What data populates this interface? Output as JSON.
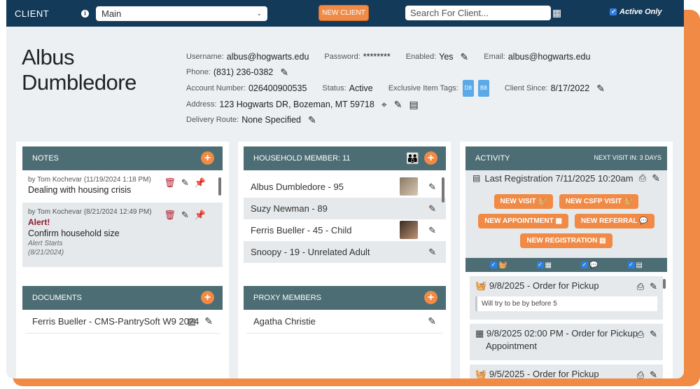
{
  "app": {
    "brand": "CLIENT",
    "select_value": "Main",
    "new_client_label": "NEW CLIENT",
    "search_placeholder": "Search For Client...",
    "active_only_label": "Active Only"
  },
  "client": {
    "name": "Albus Dumbledore",
    "username_label": "Username:",
    "username": "albus@hogwarts.edu",
    "password_label": "Password:",
    "password": "********",
    "enabled_label": "Enabled:",
    "enabled": "Yes",
    "email_label": "Email:",
    "email": "albus@hogwarts.edu",
    "phone_label": "Phone:",
    "phone": "(831) 236-0382",
    "account_label": "Account Number:",
    "account": "026400900535",
    "status_label": "Status:",
    "status": "Active",
    "tags_label": "Exclusive Item Tags:",
    "tags": [
      "D8",
      "B8"
    ],
    "since_label": "Client Since:",
    "since": "8/17/2022",
    "address_label": "Address:",
    "address": "123 Hogwarts DR, Bozeman, MT 59718",
    "route_label": "Delivery Route:",
    "route": "None Specified"
  },
  "notes": {
    "title": "NOTES",
    "items": [
      {
        "meta": "by Tom Kochevar (11/19/2024 1:18 PM)",
        "text": "Dealing with housing crisis"
      },
      {
        "meta": "by Tom Kochevar (8/21/2024 12:49 PM)",
        "alert": "Alert!",
        "text": "Confirm household size",
        "starts_label": "Alert Starts",
        "starts_date": "(8/21/2024)"
      }
    ]
  },
  "household": {
    "title": "HOUSEHOLD MEMBER: 11",
    "members": [
      "Albus Dumbledore - 95",
      "Suzy Newman - 89",
      "Ferris Bueller - 45 - Child",
      "Snoopy - 19 - Unrelated Adult"
    ]
  },
  "activity": {
    "title": "ACTIVITY",
    "next_visit": "NEXT VISIT IN: 3 DAYS",
    "last_registration": "Last Registration 7/11/2025 10:20am",
    "buttons": {
      "new_visit": "NEW VISIT",
      "new_csfp": "NEW CSFP VISIT",
      "new_appointment": "NEW APPOINTMENT",
      "new_referral": "NEW REFERRAL",
      "new_registration": "NEW REGISTRATION"
    },
    "orders": [
      {
        "title": "9/8/2025 - Order for Pickup",
        "note": "Will try to be by before 5"
      },
      {
        "title": "9/8/2025 02:00 PM - Order for Pickup",
        "subtitle": "Appointment"
      },
      {
        "title": "9/5/2025 - Order for Pickup"
      }
    ]
  },
  "documents": {
    "title": "DOCUMENTS",
    "items": [
      "Ferris Bueller - CMS-PantrySoft W9 2024"
    ]
  },
  "proxy": {
    "title": "PROXY MEMBERS",
    "items": [
      "Agatha Christie"
    ]
  },
  "colors": {
    "navy": "#143a5a",
    "orange": "#f08a45",
    "panel_header": "#4d6d74",
    "alert_red": "#8b1a2b"
  }
}
